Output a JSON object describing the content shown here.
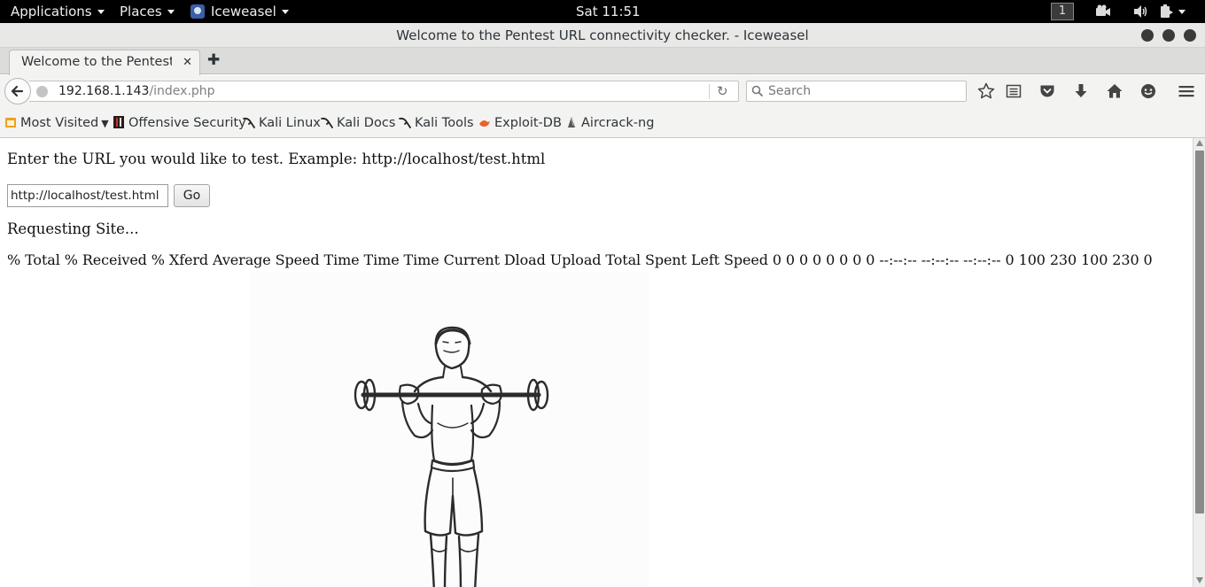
{
  "topbar": {
    "applications": "Applications",
    "places": "Places",
    "browser": "Iceweasel",
    "clock": "Sat 11:51",
    "workspace": "1"
  },
  "window": {
    "title": "Welcome to the Pentest URL connectivity checker. - Iceweasel"
  },
  "tabs": [
    {
      "label": "Welcome to the Pentest ..."
    }
  ],
  "navbar": {
    "url_host": "192.168.1.143",
    "url_path": "/index.php",
    "search_placeholder": "Search"
  },
  "bookmarks": [
    {
      "label": "Most Visited",
      "icon": "most-visited-icon"
    },
    {
      "label": "Offensive Security",
      "icon": "offsec-icon"
    },
    {
      "label": "Kali Linux",
      "icon": "kali-icon"
    },
    {
      "label": "Kali Docs",
      "icon": "kali-icon"
    },
    {
      "label": "Kali Tools",
      "icon": "kali-icon"
    },
    {
      "label": "Exploit-DB",
      "icon": "exploitdb-icon"
    },
    {
      "label": "Aircrack-ng",
      "icon": "aircrack-icon"
    }
  ],
  "page": {
    "prompt": "Enter the URL you would like to test. Example: http://localhost/test.html",
    "input_value": "http://localhost/test.html",
    "go_label": "Go",
    "requesting": "Requesting Site...",
    "curl_output": "% Total % Received % Xferd Average Speed Time Time Time Current Dload Upload Total Spent Left Speed 0 0 0 0 0 0 0 0 --:--:-- --:--:-- --:--:-- 0 100 230 100 230 0"
  },
  "colors": {
    "topbar_bg": "#000000",
    "chrome_bg": "#f3f3f2",
    "scroll_thumb": "#8a8a88"
  }
}
